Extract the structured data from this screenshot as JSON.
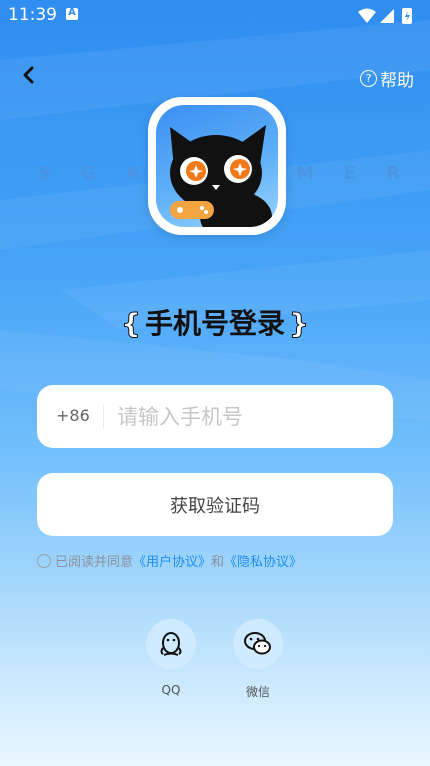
{
  "status_bar": {
    "time": "11:39",
    "notification_letter": "A"
  },
  "header": {
    "help_icon_glyph": "?",
    "help_label": "帮助"
  },
  "background_brand": {
    "left_text": "SGA",
    "right_text": "MER"
  },
  "title": {
    "open_brace": "{",
    "text": "手机号登录",
    "close_brace": "}"
  },
  "phone_field": {
    "country_code": "+86",
    "value": "",
    "placeholder": "请输入手机号"
  },
  "code_button": {
    "label": "获取验证码"
  },
  "agreement": {
    "prefix": "已阅读并同意",
    "user_agreement": "《用户协议》",
    "conjunction": "和",
    "privacy_policy": "《隐私协议》"
  },
  "social_login": {
    "qq_label": "QQ",
    "wechat_label": "微信"
  },
  "colors": {
    "background_top": "#2f8df0",
    "background_bottom": "#eaf6ff",
    "link": "#1a8ff0",
    "title_text": "#111111"
  }
}
